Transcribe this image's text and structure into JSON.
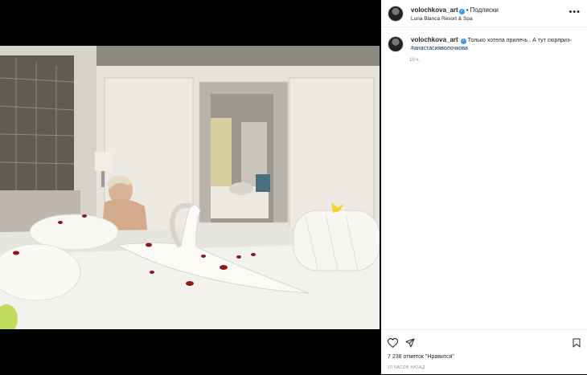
{
  "post": {
    "username": "volochkova_art",
    "verified_mark": "✓",
    "separator": "•",
    "follow_label": "Подписки",
    "location": "Luna Blanca Resort & Spa",
    "more_label": "•••"
  },
  "caption": {
    "username": "volochkova_art",
    "text": "Только хотела прилечь.. А тут сюрприз",
    "hashtag": "#анастасияволочкова",
    "time_ago": "10 ч."
  },
  "actions": {
    "likes_text": "7 238 отметок \"Нравится\"",
    "timestamp": "10 ЧАСОВ НАЗАД"
  },
  "icons": {
    "like": "heart-icon",
    "share": "share-icon",
    "save": "bookmark-icon",
    "more": "more-icon"
  },
  "colors": {
    "link": "#00376b",
    "verified": "#3897f0",
    "muted": "#8e8e8e",
    "text": "#262626"
  }
}
